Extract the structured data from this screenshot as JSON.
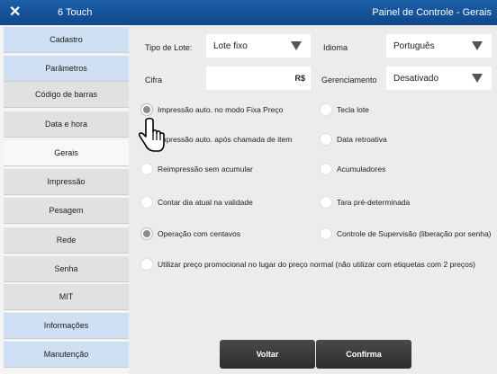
{
  "titlebar": {
    "close": "✕",
    "app_name": "6 Touch",
    "title": "Painel de Controle - Gerais"
  },
  "sidebar": {
    "items": [
      {
        "label": "Cadastro"
      },
      {
        "label": "Parâmetros"
      },
      {
        "label": "Código de barras"
      },
      {
        "label": "Data e hora"
      },
      {
        "label": "Gerais"
      },
      {
        "label": "Impressão"
      },
      {
        "label": "Pesagem"
      },
      {
        "label": "Rede"
      },
      {
        "label": "Senha"
      },
      {
        "label": "MIT"
      },
      {
        "label": "Informações"
      },
      {
        "label": "Manutenção"
      }
    ],
    "active": "Gerais"
  },
  "form": {
    "tipo_lote_label": "Tipo de Lote:",
    "tipo_lote_value": "Lote fixo",
    "idioma_label": "Idioma",
    "idioma_value": "Português",
    "cifra_label": "Cifra",
    "cifra_value": "",
    "cifra_suffix": "R$",
    "gerenciamento_label": "Gerenciamento",
    "gerenciamento_value": "Desativado"
  },
  "options": {
    "left": [
      {
        "label": "Impressão auto. no modo Fixa Preço",
        "checked": true
      },
      {
        "label": "Impressão auto. após chamada de item",
        "checked": false
      },
      {
        "label": "Reimpressão sem acumular",
        "checked": false
      },
      {
        "label": "Contar dia atual na validade",
        "checked": false
      },
      {
        "label": "Operação com centavos",
        "checked": true
      }
    ],
    "right": [
      {
        "label": "Tecla lote",
        "checked": false
      },
      {
        "label": "Data retroativa",
        "checked": false
      },
      {
        "label": "Acumuladores",
        "checked": false
      },
      {
        "label": "Tara pré-determinada",
        "checked": false
      },
      {
        "label": "Controle de Supervisão (liberação por senha)",
        "checked": false
      }
    ],
    "bottom": {
      "label": "Utilizar preço promocional no lugar do preço normal (não utilizar com etiquetas com 2 preços)",
      "checked": false
    }
  },
  "buttons": {
    "voltar": "Voltar",
    "confirma": "Confirma"
  },
  "colors": {
    "titlebar": "#1656a0",
    "sidebar_blue": "#cfe0f4",
    "button": "#3a3a3a"
  },
  "icons": {
    "close": "close-icon",
    "cursor": "hand-cursor-icon"
  }
}
